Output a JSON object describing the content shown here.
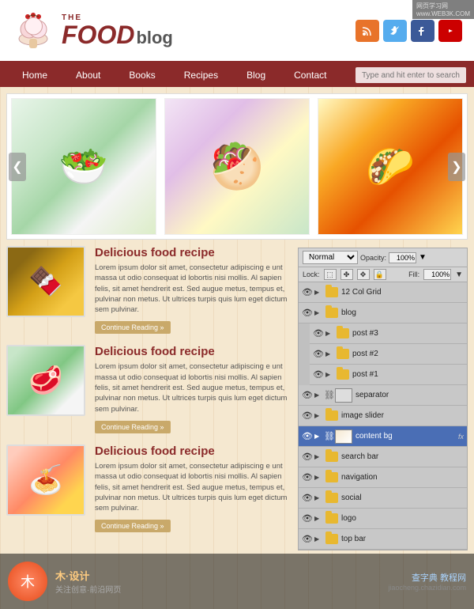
{
  "header": {
    "logo_the": "THE",
    "logo_food": "FOOD",
    "logo_blog": "blog",
    "social_icons": [
      "RSS",
      "T",
      "f",
      "▶"
    ]
  },
  "nav": {
    "links": [
      "Home",
      "About",
      "Books",
      "Recipes",
      "Blog",
      "Contact"
    ],
    "search_placeholder": "Type and hit enter to search"
  },
  "slider": {
    "left_arrow": "❮",
    "right_arrow": "❯"
  },
  "posts": [
    {
      "title": "Delicious food recipe",
      "text": "Lorem ipsum dolor sit amet, consectetur adipiscing e unt massa ut odio consequat id lobortis nisi mollis. Al sapien felis, sit amet hendrerit est. Sed augue metus, tempus et, pulvinar non metus. Ut ultrices turpis quis lum eget dictum sem pulvinar.",
      "read_more": "Continue Reading »"
    },
    {
      "title": "Delicious food recipe",
      "text": "Lorem ipsum dolor sit amet, consectetur adipiscing e unt massa ut odio consequat id lobortis nisi mollis. Al sapien felis, sit amet hendrerit est. Sed augue metus, tempus et, pulvinar non metus. Ut ultrices turpis quis lum eget dictum sem pulvinar.",
      "read_more": "Continue Reading »"
    },
    {
      "title": "Delicious food recipe",
      "text": "Lorem ipsum dolor sit amet, consectetur adipiscing e unt massa ut odio consequat id lobortis nisi mollis. Al sapien felis, sit amet hendrerit est. Sed augue metus, tempus et, pulvinar non metus. Ut ultrices turpis quis lum eget dictum sem pulvinar.",
      "read_more": "Continue Reading »"
    }
  ],
  "layers_panel": {
    "blend_mode": "Normal",
    "opacity_label": "Opacity:",
    "opacity_value": "100%",
    "lock_label": "Lock:",
    "fill_label": "Fill:",
    "fill_value": "100%",
    "layers": [
      {
        "name": "12 Col Grid",
        "type": "folder",
        "indent": 0
      },
      {
        "name": "blog",
        "type": "folder",
        "indent": 0
      },
      {
        "name": "post #3",
        "type": "folder",
        "indent": 1
      },
      {
        "name": "post #2",
        "type": "folder",
        "indent": 1
      },
      {
        "name": "post #1",
        "type": "folder",
        "indent": 1
      },
      {
        "name": "separator",
        "type": "layer_thumb",
        "indent": 0
      },
      {
        "name": "image slider",
        "type": "folder",
        "indent": 0
      },
      {
        "name": "content bg",
        "type": "layer_thumb",
        "indent": 0,
        "fx": true,
        "active": true
      },
      {
        "name": "search bar",
        "type": "folder",
        "indent": 0
      },
      {
        "name": "navigation",
        "type": "folder",
        "indent": 0
      },
      {
        "name": "social",
        "type": "folder",
        "indent": 0
      },
      {
        "name": "logo",
        "type": "folder",
        "indent": 0
      },
      {
        "name": "top bar",
        "type": "folder",
        "indent": 0
      }
    ]
  },
  "watermark": {
    "top_right_line1": "网页学习网",
    "top_right_line2": "www.WEB3K.COM",
    "logo_icon": "木",
    "bottom_left_text": "木·设计",
    "bottom_left_sub": "关注创意·前沿网页",
    "bottom_right_text": "查字典 教程网",
    "bottom_right_sub": "jiaocheng.chazidian.com"
  }
}
